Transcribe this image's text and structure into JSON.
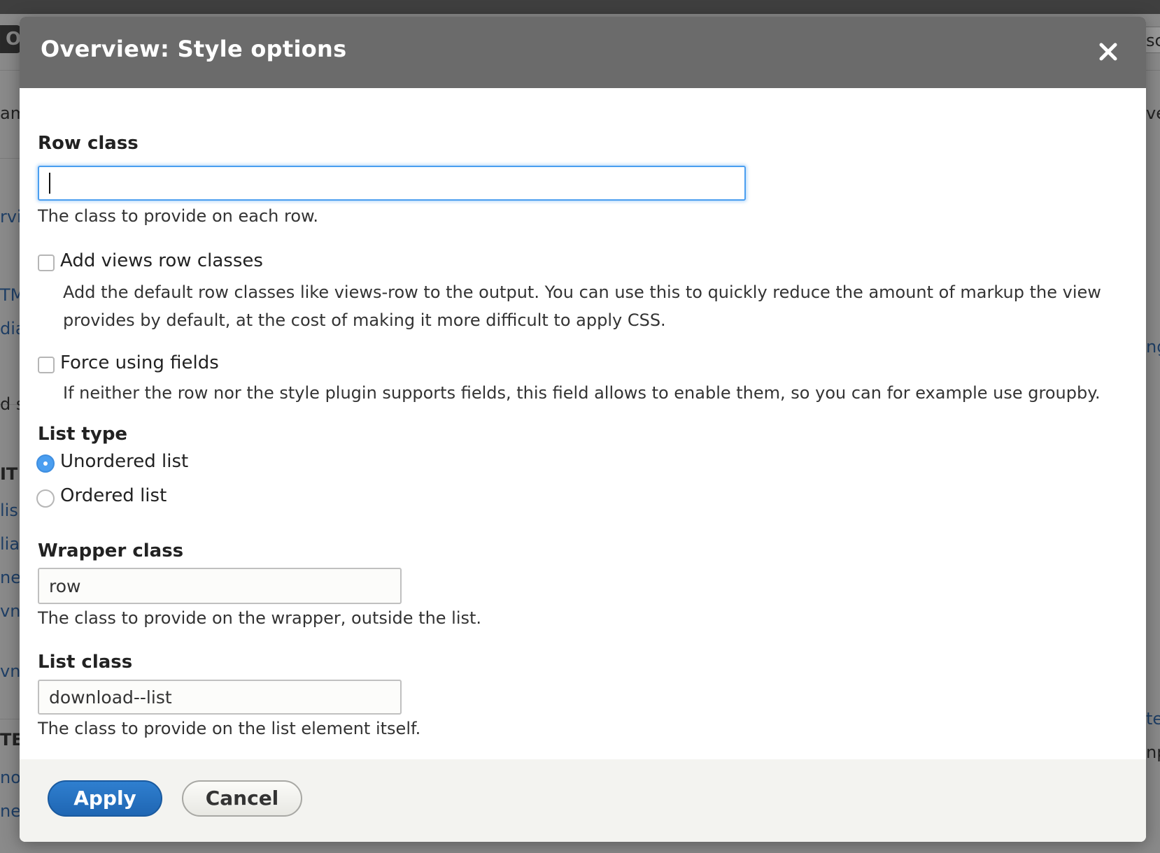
{
  "background": {
    "left_fragments": [
      "O",
      "am",
      "rvi",
      "TM",
      "dia",
      "d s",
      "IT",
      "lis",
      "lia",
      "ne",
      "vnl",
      "vnl",
      "TE",
      "no",
      "ne"
    ],
    "right_fragments": [
      "sc",
      "ve",
      "ng",
      "te",
      "np"
    ]
  },
  "dialog": {
    "title": "Overview: Style options",
    "close_label": "×"
  },
  "form": {
    "row_class": {
      "label": "Row class",
      "value": "",
      "description": "The class to provide on each row."
    },
    "add_views_row_classes": {
      "label": "Add views row classes",
      "checked": false,
      "description_line1": "Add the default row classes like views-row to the output. You can use this to quickly reduce the amount of markup the view",
      "description_line2": "provides by default, at the cost of making it more difficult to apply CSS."
    },
    "force_using_fields": {
      "label": "Force using fields",
      "checked": false,
      "description": "If neither the row nor the style plugin supports fields, this field allows to enable them, so you can for example use groupby."
    },
    "list_type": {
      "label": "List type",
      "options": [
        {
          "label": "Unordered list",
          "selected": true
        },
        {
          "label": "Ordered list",
          "selected": false
        }
      ]
    },
    "wrapper_class": {
      "label": "Wrapper class",
      "value": "row",
      "description": "The class to provide on the wrapper, outside the list."
    },
    "list_class": {
      "label": "List class",
      "value": "download--list",
      "description": "The class to provide on the list element itself."
    }
  },
  "footer": {
    "apply_label": "Apply",
    "cancel_label": "Cancel"
  },
  "colors": {
    "header_bg": "#6b6b6b",
    "primary_button": "#1f66b3",
    "focus_ring": "#4a9ef0",
    "footer_bg": "#f3f3f0"
  }
}
